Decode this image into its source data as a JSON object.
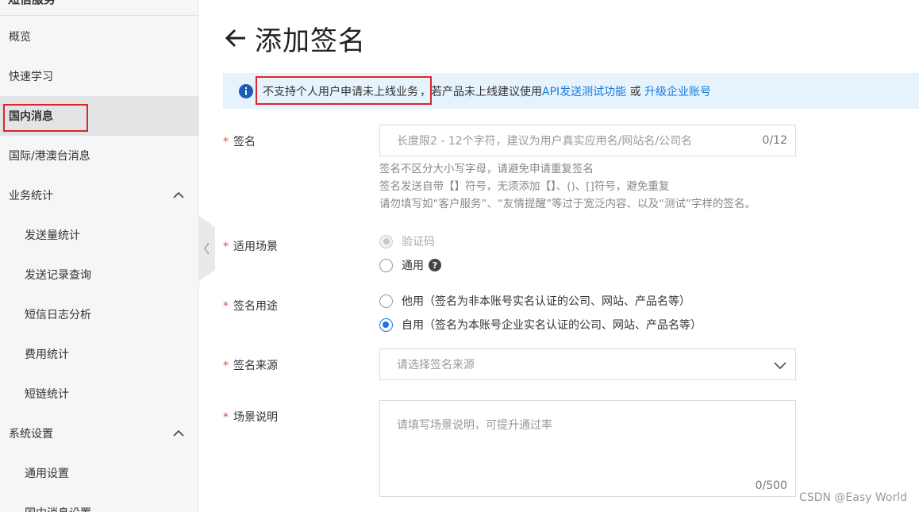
{
  "sidebar": {
    "top_title": "短信服务",
    "items": [
      {
        "label": "概览"
      },
      {
        "label": "快速学习"
      },
      {
        "label": "国内消息"
      },
      {
        "label": "国际/港澳台消息"
      },
      {
        "label": "业务统计"
      },
      {
        "label": "发送量统计"
      },
      {
        "label": "发送记录查询"
      },
      {
        "label": "短信日志分析"
      },
      {
        "label": "费用统计"
      },
      {
        "label": "短链统计"
      },
      {
        "label": "系统设置"
      },
      {
        "label": "通用设置"
      },
      {
        "label": "国内消息设置"
      }
    ]
  },
  "header": {
    "title": "添加签名"
  },
  "notice": {
    "text_highlight": "不支持个人用户申请未上线业务",
    "text_mid": "，若产品未上线建议使用",
    "link1": "API发送测试功能",
    "text_or": " 或 ",
    "link2": "升级企业账号"
  },
  "form": {
    "signature": {
      "label": "签名",
      "placeholder": "长度限2 - 12个字符，建议为用户真实应用名/网站名/公司名",
      "counter": "0/12",
      "hints": [
        "签名不区分大小写字母，请避免申请重复签名",
        "签名发送自带【】符号，无须添加【】、()、[]符号，避免重复",
        "请勿填写如“客户服务”、“友情提醒”等过于宽泛内容、以及“测试”字样的签名。"
      ]
    },
    "scenario": {
      "label": "适用场景",
      "options": [
        "验证码",
        "通用"
      ],
      "help": "?"
    },
    "usage": {
      "label": "签名用途",
      "options": [
        "他用（签名为非本账号实名认证的公司、网站、产品名等）",
        "自用（签名为本账号企业实名认证的公司、网站、产品名等）"
      ]
    },
    "source": {
      "label": "签名来源",
      "placeholder": "请选择签名来源"
    },
    "description": {
      "label": "场景说明",
      "placeholder": "请填写场景说明，可提升通过率",
      "counter": "0/500"
    },
    "required_mark": "*"
  },
  "watermark": "CSDN @Easy World",
  "colors": {
    "link": "#1a7ad9",
    "notice_bg": "#e6f3fd",
    "highlight_border": "#d9272a",
    "radio_checked": "#1a73e8",
    "required": "#e04b2d"
  }
}
